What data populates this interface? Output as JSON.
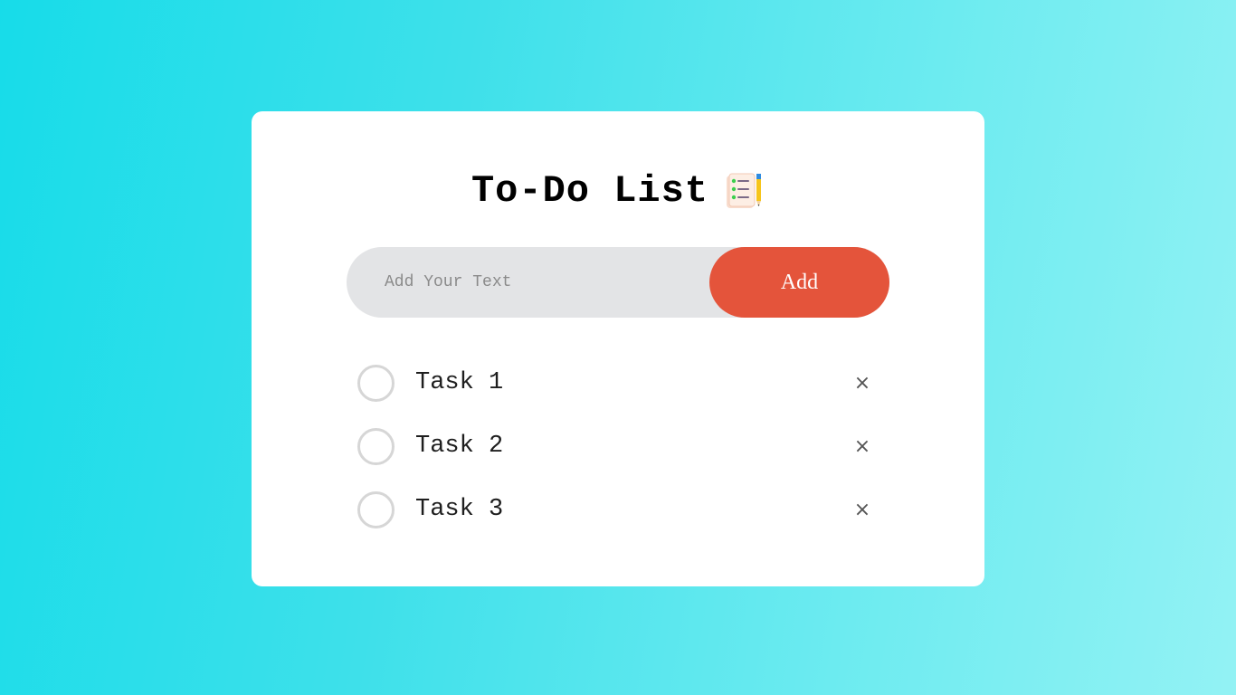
{
  "app": {
    "title": "To-Do List",
    "title_icon": "notepad-pencil-icon"
  },
  "input": {
    "placeholder": "Add Your Text",
    "value": ""
  },
  "add_button": {
    "label": "Add",
    "color": "#e4543b"
  },
  "tasks": [
    {
      "label": "Task 1",
      "checked": false,
      "remove_symbol": "×"
    },
    {
      "label": "Task 2",
      "checked": false,
      "remove_symbol": "×"
    },
    {
      "label": "Task 3",
      "checked": false,
      "remove_symbol": "×"
    }
  ],
  "colors": {
    "background_start": "#17dce9",
    "background_end": "#93f2f4",
    "card": "#ffffff",
    "input_bg": "#e3e4e6"
  }
}
